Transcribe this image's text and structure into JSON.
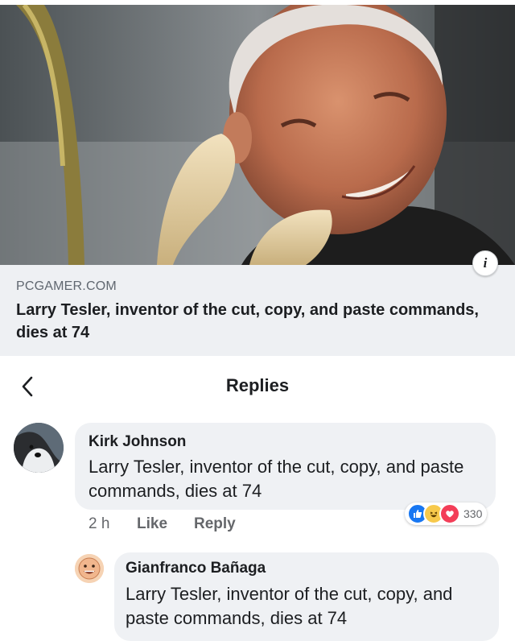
{
  "link_card": {
    "domain": "PCGAMER.COM",
    "title": "Larry Tesler, inventor of the cut, copy, and paste commands, dies at 74",
    "info_glyph": "i"
  },
  "header": {
    "title": "Replies",
    "back_icon": "chevron-left-icon"
  },
  "comments": [
    {
      "author": "Kirk Johnson",
      "text": "Larry Tesler, inventor of the cut, copy, and paste commands, dies at 74",
      "time": "2 h",
      "like_label": "Like",
      "reply_label": "Reply",
      "reactions": [
        "like",
        "haha",
        "love"
      ],
      "reaction_count": "330"
    },
    {
      "author": "Gianfranco Bañaga",
      "text": "Larry Tesler, inventor of the cut, copy, and paste commands, dies at 74"
    }
  ],
  "colors": {
    "like": "#1877f2",
    "haha": "#f7c94b",
    "love": "#f33e58",
    "bubble": "#eff1f4",
    "meta_text": "#65676b"
  }
}
